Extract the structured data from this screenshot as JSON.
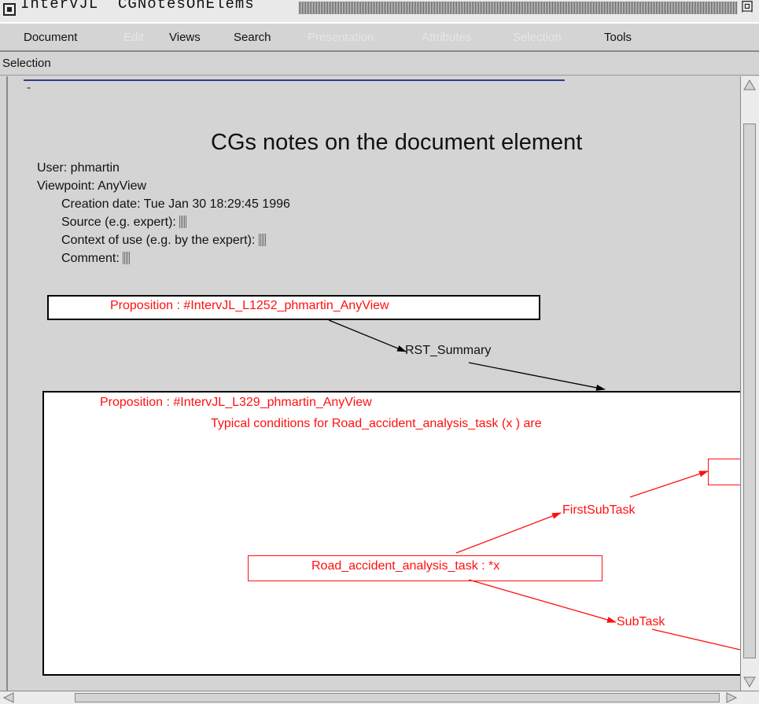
{
  "window": {
    "title": "InterVJL  CGNotesOnElems",
    "maximize_glyph": "回"
  },
  "menubar": {
    "items": [
      {
        "label": "Document",
        "enabled": true
      },
      {
        "label": "Edit",
        "enabled": false
      },
      {
        "label": "Views",
        "enabled": true
      },
      {
        "label": "Search",
        "enabled": true
      },
      {
        "label": "Presentation",
        "enabled": false
      },
      {
        "label": "Attributes",
        "enabled": false
      },
      {
        "label": "Selection",
        "enabled": false
      },
      {
        "label": "Tools",
        "enabled": true
      }
    ]
  },
  "selection_bar": {
    "label": "Selection"
  },
  "document": {
    "marker": "-",
    "heading": "CGs notes on the document element",
    "user": "User: phmartin",
    "viewpoint": "Viewpoint: AnyView",
    "creation_date": "Creation date: Tue Jan 30 18:29:45 1996",
    "source": "Source (e.g. expert):",
    "context": "Context of use (e.g. by the expert):",
    "comment": "Comment:"
  },
  "graph": {
    "top_proposition": "Proposition : #IntervJL_L1252_phmartin_AnyView",
    "relation_summary": "RST_Summary",
    "inner_proposition": "Proposition : #IntervJL_L329_phmartin_AnyView",
    "inner_description": "Typical conditions for Road_accident_analysis_task (x ) are",
    "concept": "Road_accident_analysis_task : *x",
    "relation_first_subtask": "FirstSubTask",
    "relation_subtask": "SubTask"
  },
  "colors": {
    "background": "#d4d4d4",
    "graph_red": "#ff1010",
    "rule_blue": "#2f3c8a"
  }
}
